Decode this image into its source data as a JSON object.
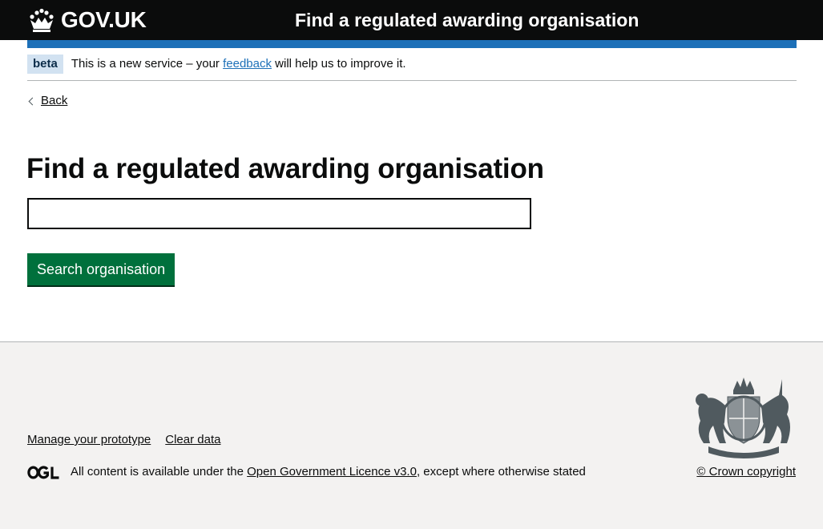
{
  "header": {
    "logo_text": "GOV.UK",
    "service_name": "Find a regulated awarding organisation"
  },
  "phase_banner": {
    "tag": "beta",
    "text_before": "This is a new service – your ",
    "link": "feedback",
    "text_after": " will help us to improve it."
  },
  "back_link": "Back",
  "main": {
    "title": "Find a regulated awarding organisation",
    "search_value": "",
    "search_button": "Search organisation"
  },
  "footer": {
    "links": [
      "Manage your prototype",
      "Clear data"
    ],
    "ogl_logo": "OGL",
    "licence_before": "All content is available under the ",
    "licence_link": "Open Government Licence v3.0",
    "licence_after": ", except where otherwise stated",
    "copyright": "© Crown copyright",
    "crest_motto": "DIEU ET MON DROIT"
  },
  "colors": {
    "header_bg": "#0b0c0c",
    "header_accent": "#1d70b8",
    "button_green": "#00703c",
    "link_blue": "#1d70b8",
    "footer_bg": "#f3f2f1"
  }
}
